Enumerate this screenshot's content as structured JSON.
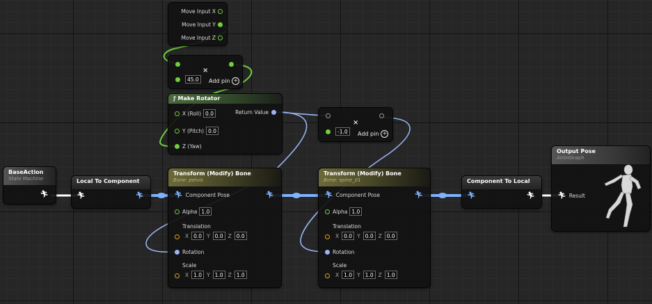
{
  "colors": {
    "exec_wire": "#ffffff",
    "pose_wire": "#7fb2ff",
    "float_wire": "#6ed03c",
    "vector_wire": "#9bb4f4",
    "transform_header": "#6c6a3a"
  },
  "nodes": {
    "base_action": {
      "title": "BaseAction",
      "subtitle": "State Machine"
    },
    "local_to_component": {
      "title": "Local To Component"
    },
    "break_input": {
      "pins": [
        "Move Input X",
        "Move Input Y",
        "Move Input Z"
      ]
    },
    "add_float": {
      "value": "45.0",
      "add_pin_label": "Add pin"
    },
    "make_rotator": {
      "title": "Make Rotator",
      "output_label": "Return Value",
      "inputs": [
        {
          "label": "X (Roll)",
          "value": "0.0"
        },
        {
          "label": "Y (Pitch)",
          "value": "0.0"
        },
        {
          "label": "Z (Yaw)",
          "value": ""
        }
      ]
    },
    "multiply": {
      "value": "-1.0",
      "add_pin_label": "Add pin"
    },
    "modify_bone_1": {
      "title": "Transform (Modify) Bone",
      "subtitle": "Bone: pelvis",
      "component_pose_label": "Component Pose",
      "alpha_label": "Alpha",
      "alpha": "1.0",
      "translation_label": "Translation",
      "translation": {
        "x": "0.0",
        "y": "0.0",
        "z": "0.0"
      },
      "rotation_label": "Rotation",
      "scale_label": "Scale",
      "scale": {
        "x": "1.0",
        "y": "1.0",
        "z": "1.0"
      }
    },
    "modify_bone_2": {
      "title": "Transform (Modify) Bone",
      "subtitle": "Bone: spine_01",
      "component_pose_label": "Component Pose",
      "alpha_label": "Alpha",
      "alpha": "1.0",
      "translation_label": "Translation",
      "translation": {
        "x": "0.0",
        "y": "0.0",
        "z": "0.0"
      },
      "rotation_label": "Rotation",
      "scale_label": "Scale",
      "scale": {
        "x": "1.0",
        "y": "1.0",
        "z": "1.0"
      }
    },
    "component_to_local": {
      "title": "Component To Local"
    },
    "output_pose": {
      "title": "Output Pose",
      "subtitle": "AnimGraph",
      "result_label": "Result"
    }
  },
  "axes": {
    "x": "X",
    "y": "Y",
    "z": "Z"
  }
}
